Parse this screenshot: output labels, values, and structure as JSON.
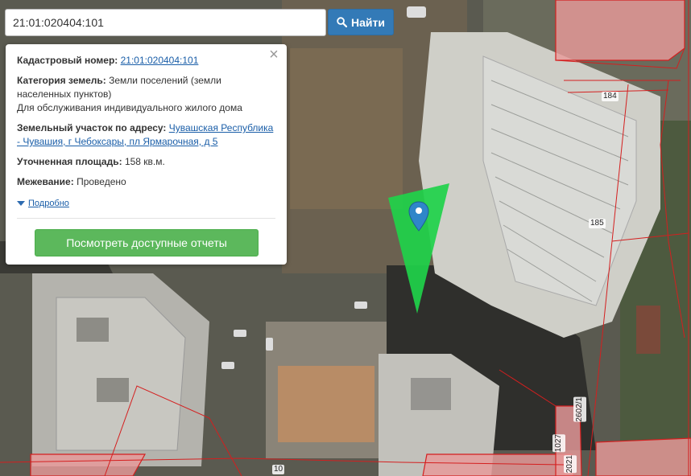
{
  "search": {
    "value": "21:01:020404:101",
    "button_label": "Найти"
  },
  "popup": {
    "cadastral_label": "Кадастровый номер:",
    "cadastral_value": "21:01:020404:101",
    "category_label": "Категория земель:",
    "category_value": "Земли поселений (земли населенных пунктов)",
    "category_usage": "Для обслуживания индивидуального жилого дома",
    "address_label": "Земельный участок по адресу:",
    "address_value": "Чувашская Республика - Чувашия, г Чебоксары, пл Ярмарочная, д 5",
    "area_label": "Уточненная площадь:",
    "area_value": "158 кв.м.",
    "survey_label": "Межевание:",
    "survey_value": "Проведено",
    "more_label": "Подробно",
    "reports_button": "Посмотреть доступные отчеты",
    "close_symbol": "×"
  },
  "map": {
    "parcel_labels": [
      "184",
      "185",
      "10",
      "2602/1",
      "1027",
      "2021"
    ],
    "colors": {
      "parcel_fill": "#e89a9a",
      "parcel_line": "#d41f1f",
      "highlight": "#1fd24a",
      "marker": "#2f86c9"
    }
  },
  "icons": {
    "search": "search-icon",
    "marker": "map-marker-icon",
    "close": "close-icon",
    "caret": "caret-down-icon"
  }
}
